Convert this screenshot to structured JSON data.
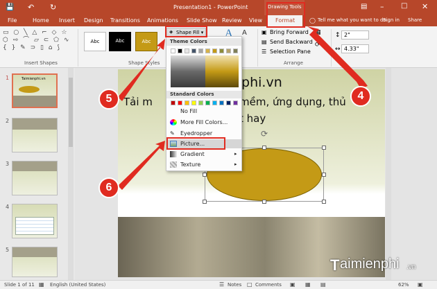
{
  "titlebar": {
    "title": "Presentation1 - PowerPoint",
    "context_label": "Drawing Tools"
  },
  "tabs": [
    "File",
    "Home",
    "Insert",
    "Design",
    "Transitions",
    "Animations",
    "Slide Show",
    "Review",
    "View",
    "Format"
  ],
  "tell_me": "Tell me what you want to do...",
  "user": "Sign in",
  "share": "Share",
  "ribbon": {
    "insert_shapes": "Insert Shapes",
    "shape_styles": "Shape Styles",
    "arrange": "Arrange",
    "style_sample": "Abc",
    "shape_fill": "Shape Fill",
    "bring_forward": "Bring Forward",
    "send_backward": "Send Backward",
    "selection_pane": "Selection Pane",
    "height": "2\"",
    "width": "4.33\""
  },
  "menu": {
    "theme_colors": "Theme Colors",
    "standard_colors": "Standard Colors",
    "items": [
      "No Fill",
      "More Fill Colors...",
      "Eyedropper",
      "Picture...",
      "Gradient",
      "Texture"
    ],
    "standard_swatches": [
      "#c00000",
      "#ff0000",
      "#ffc000",
      "#ffff00",
      "#92d050",
      "#00b050",
      "#00b0f0",
      "#0070c0",
      "#002060",
      "#7030a0"
    ]
  },
  "slide": {
    "title_visible": "nphi.vn",
    "line1_left": "Tải m",
    "line1_right": "mềm, ứng dụng, thủ",
    "line2": "t hay"
  },
  "thumb_numbers": [
    "1",
    "2",
    "3",
    "4",
    "5"
  ],
  "thumb1_title": "Taimienphi.vn",
  "status": {
    "slide": "Slide 1 of 11",
    "language": "English (United States)",
    "notes": "Notes",
    "comments": "Comments",
    "zoom": "62%"
  },
  "annotations": [
    "4",
    "5",
    "6"
  ],
  "watermark": {
    "brand": "aimienphi",
    "suffix": ".vn"
  }
}
